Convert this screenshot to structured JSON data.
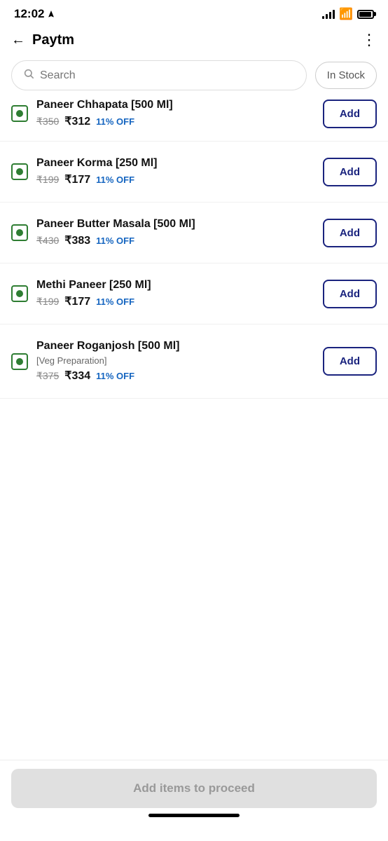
{
  "statusBar": {
    "time": "12:02",
    "navigation_icon": "navigation-arrow"
  },
  "header": {
    "back_label": "←",
    "title": "Paytm",
    "menu_label": "⋮"
  },
  "search": {
    "placeholder": "Search",
    "filter_label": "In Stock"
  },
  "partialItem": {
    "name": "Paneer Chhapata [500 Ml]",
    "original_price": "₹350",
    "discounted_price": "₹312",
    "discount": "11% OFF",
    "add_label": "Add"
  },
  "products": [
    {
      "id": 1,
      "name": "Paneer Korma [250 Ml]",
      "sub_label": "",
      "original_price": "₹199",
      "discounted_price": "₹177",
      "discount": "11% OFF",
      "add_label": "Add"
    },
    {
      "id": 2,
      "name": "Paneer Butter Masala [500 Ml]",
      "sub_label": "",
      "original_price": "₹430",
      "discounted_price": "₹383",
      "discount": "11% OFF",
      "add_label": "Add"
    },
    {
      "id": 3,
      "name": "Methi Paneer [250 Ml]",
      "sub_label": "",
      "original_price": "₹199",
      "discounted_price": "₹177",
      "discount": "11% OFF",
      "add_label": "Add"
    },
    {
      "id": 4,
      "name": "Paneer Roganjosh [500 Ml]",
      "sub_label": "[Veg Preparation]",
      "original_price": "₹375",
      "discounted_price": "₹334",
      "discount": "11% OFF",
      "add_label": "Add"
    }
  ],
  "bottomBar": {
    "proceed_label": "Add items to proceed"
  }
}
